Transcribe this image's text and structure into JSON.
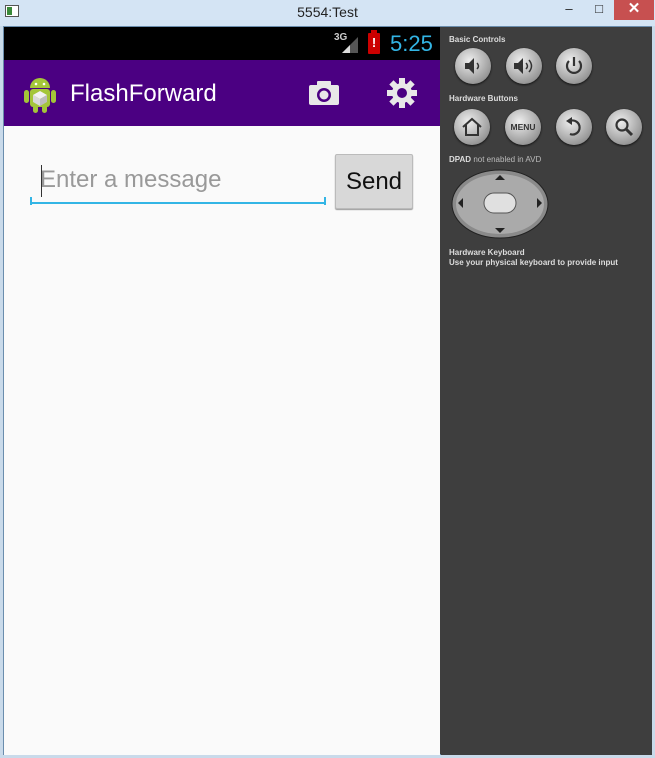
{
  "window": {
    "title": "5554:Test",
    "minimize": "–",
    "maximize": "□",
    "close": "✕"
  },
  "android": {
    "status_bar": {
      "network": "3G",
      "battery_alert": "!",
      "clock": "5:25",
      "clock_color": "#33b5e5"
    },
    "action_bar": {
      "title": "FlashForward",
      "color": "#4b0082",
      "icons": [
        "android-icon",
        "camera-icon",
        "settings-gear-icon"
      ]
    },
    "compose": {
      "input_value": "",
      "input_placeholder": "Enter a message",
      "send_label": "Send"
    }
  },
  "emulator_controls": {
    "basic_controls_label": "Basic Controls",
    "basic_controls": [
      "volume-down-icon",
      "volume-up-icon",
      "power-icon"
    ],
    "hardware_buttons_label": "Hardware Buttons",
    "hardware_buttons": [
      "home-icon",
      "menu-button",
      "back-icon",
      "search-icon"
    ],
    "menu_label": "MENU",
    "dpad_label": "DPAD",
    "dpad_note": "not enabled in AVD",
    "keyboard_label": "Hardware Keyboard",
    "keyboard_note": "Use your physical keyboard to provide input"
  }
}
